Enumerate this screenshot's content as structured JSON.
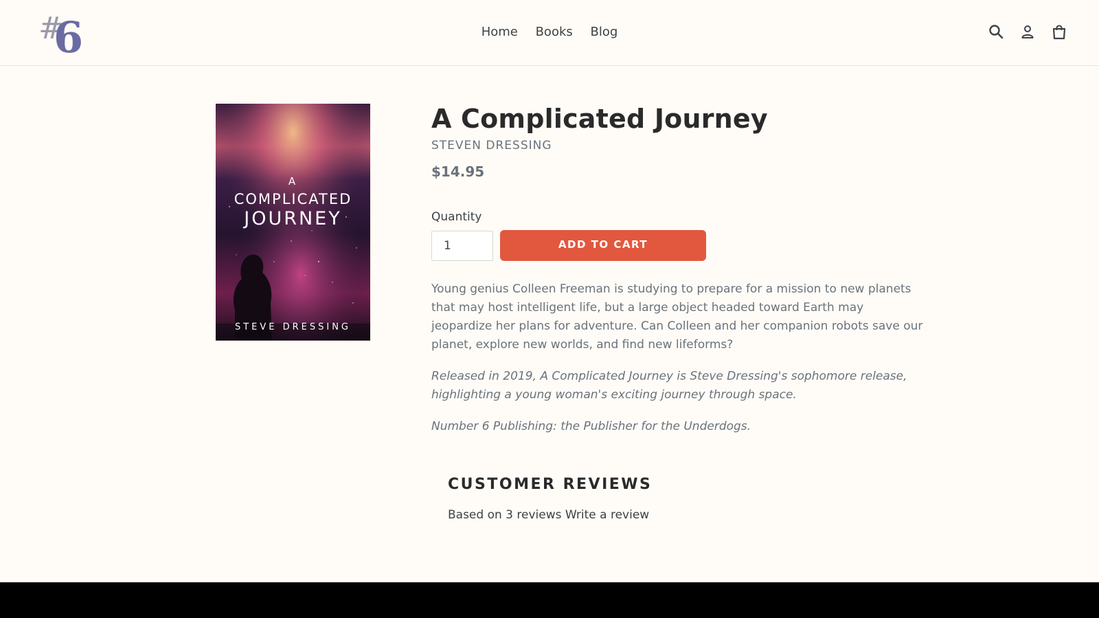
{
  "header": {
    "logo_text": "#6",
    "nav": [
      "Home",
      "Books",
      "Blog"
    ],
    "icons": [
      "search-icon",
      "account-icon",
      "cart-icon"
    ]
  },
  "product": {
    "cover": {
      "line_a": "A",
      "line_1": "COMPLICATED",
      "line_2": "JOURNEY",
      "author": "STEVE DRESSING"
    },
    "title": "A Complicated Journey",
    "author": "STEVEN DRESSING",
    "price": "$14.95",
    "quantity_label": "Quantity",
    "quantity_value": "1",
    "add_to_cart": "ADD TO CART",
    "description": [
      "Young genius Colleen Freeman is studying to prepare for a mission to new planets that may host intelligent life, but a large object headed toward Earth may jeopardize her plans for adventure. Can Colleen and her companion robots save our planet, explore new worlds, and find new lifeforms?",
      "Released in 2019, A Complicated Journey is Steve Dressing's sophomore release, highlighting a young woman's exciting journey through space.",
      "Number 6 Publishing: the Publisher for the Underdogs."
    ]
  },
  "reviews": {
    "title": "CUSTOMER REVIEWS",
    "summary": "Based on 3 reviews",
    "write_link": "Write a review"
  },
  "colors": {
    "background": "#fffcf7",
    "accent": "#e2583e",
    "logo": "#6b6ba3",
    "footer": "#000000"
  }
}
